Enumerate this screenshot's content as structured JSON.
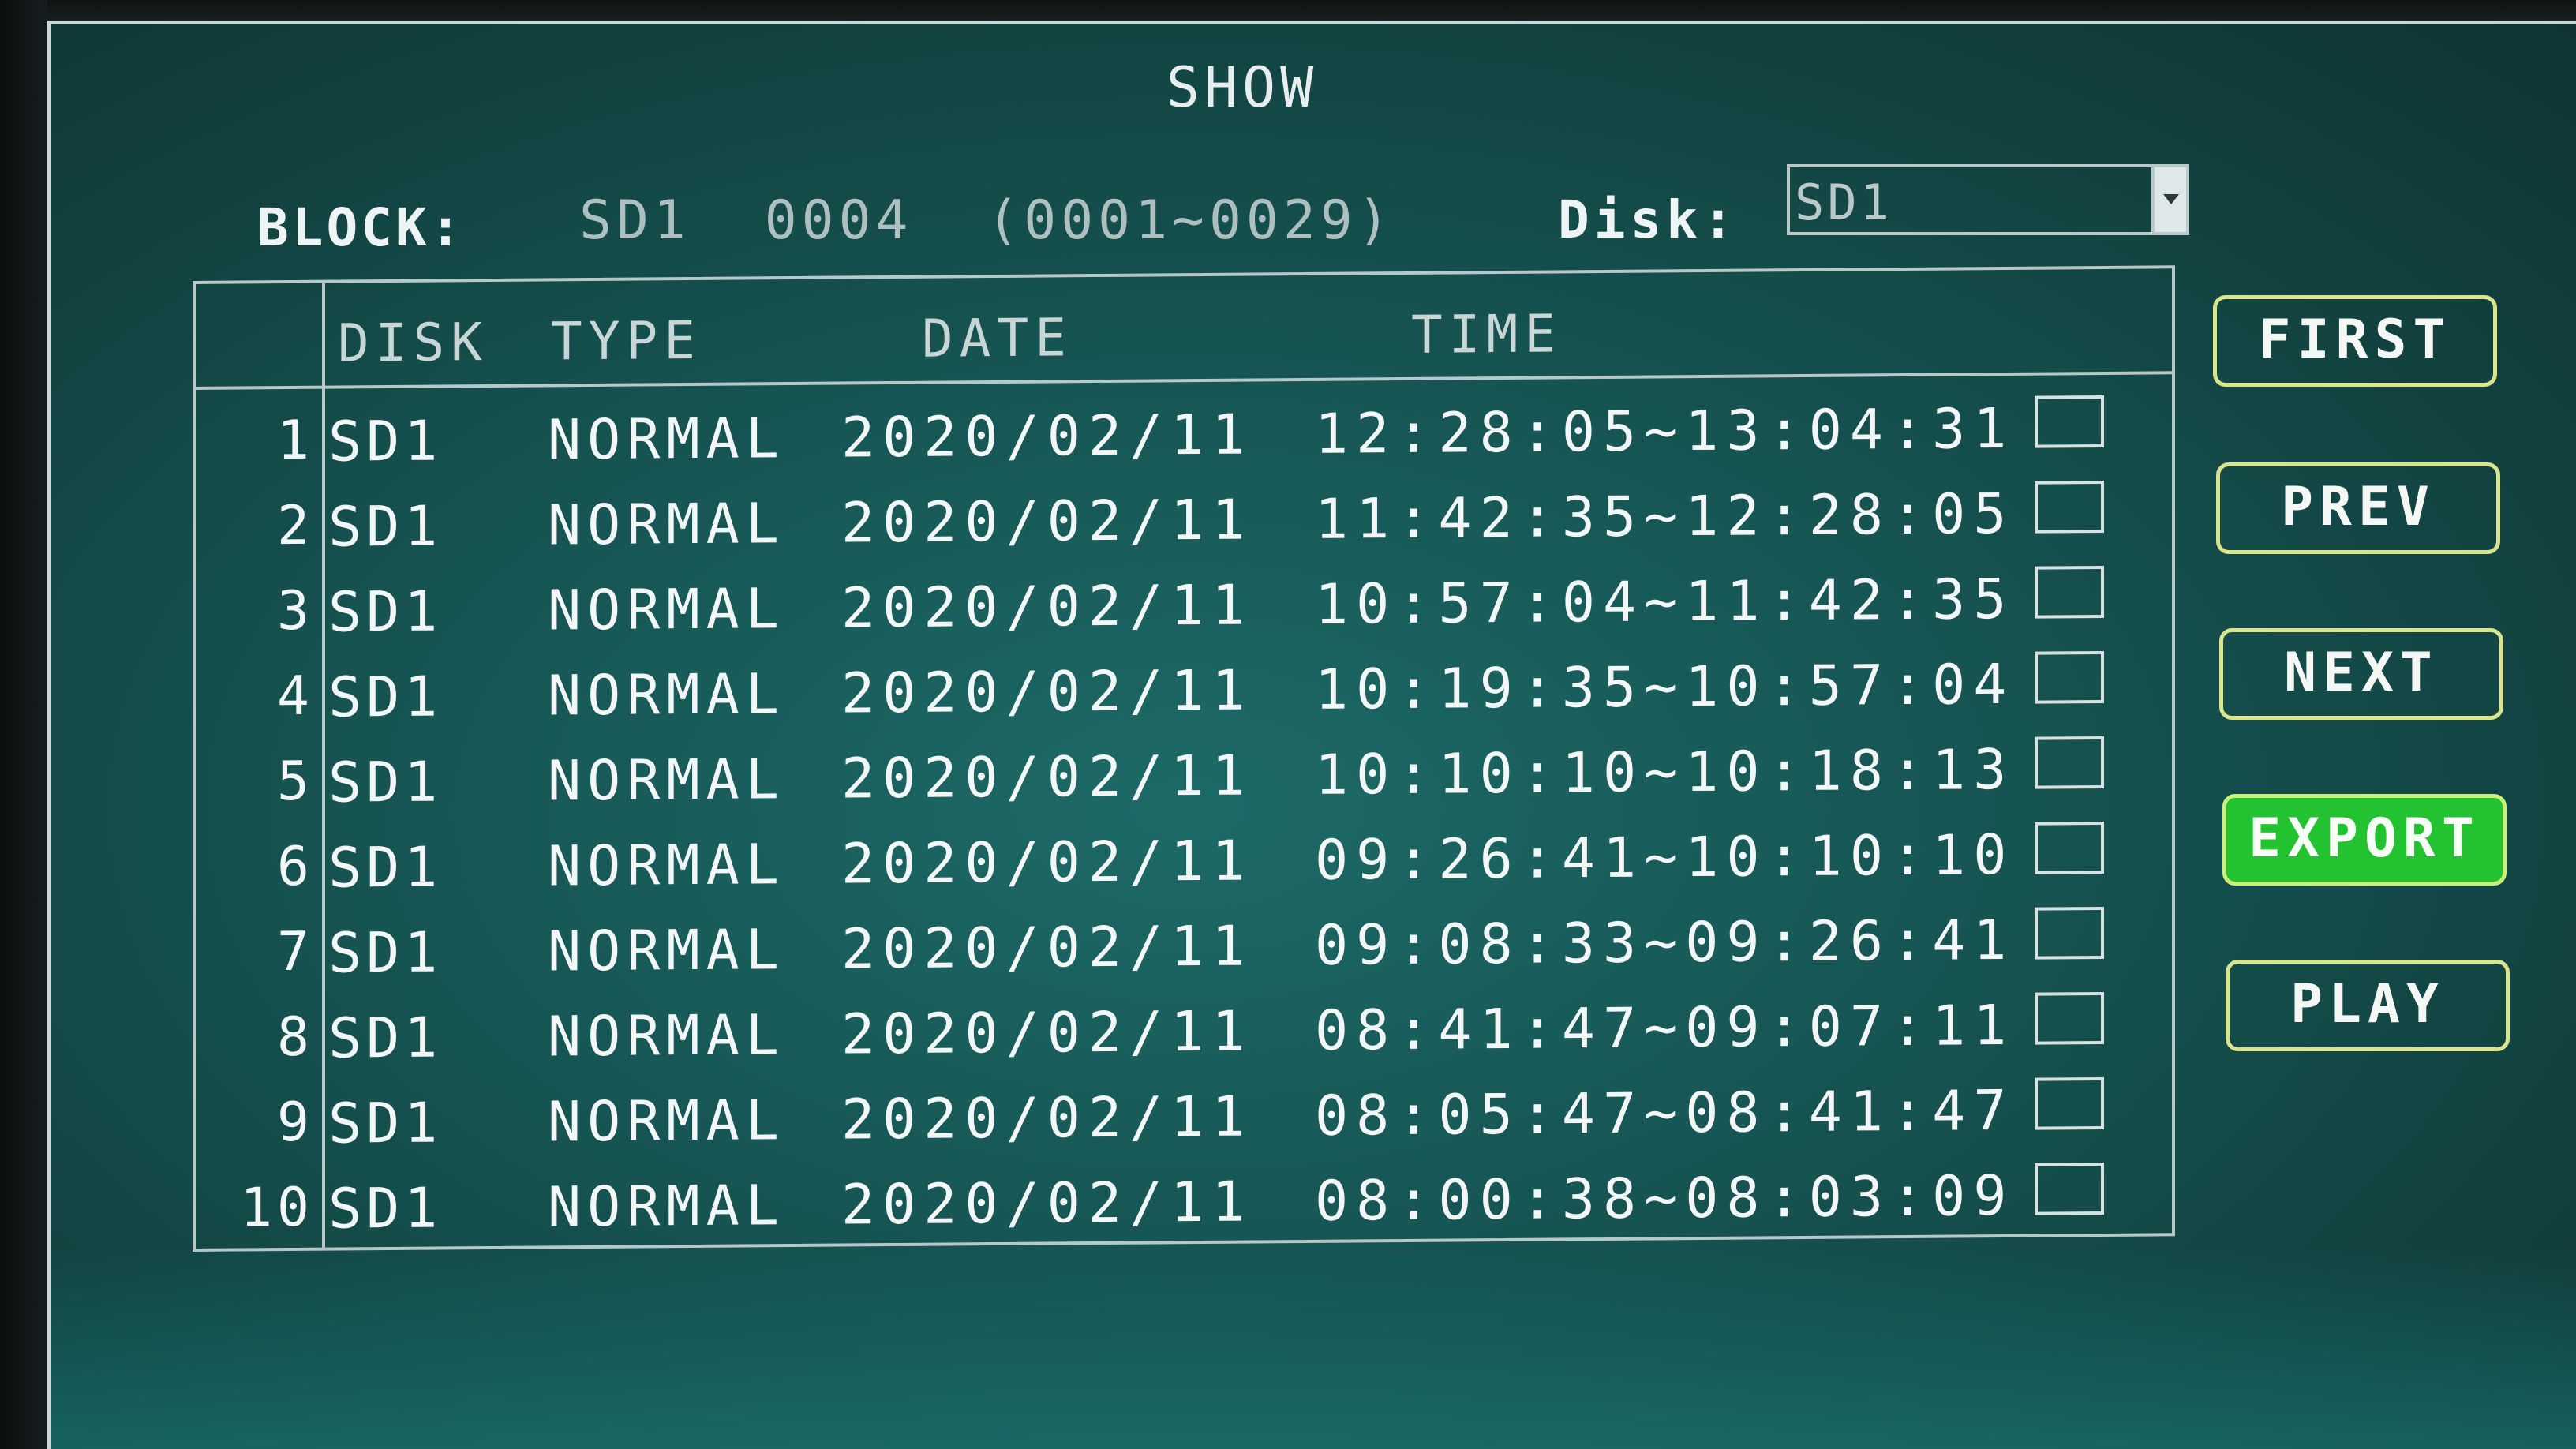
{
  "title": "SHOW",
  "block": {
    "label": "BLOCK:",
    "value": "SD1  0004  (0001~0029)"
  },
  "disk": {
    "label": "Disk:",
    "selected": "SD1"
  },
  "table": {
    "columns": [
      "DISK",
      "TYPE",
      "DATE",
      "TIME"
    ],
    "rows": [
      {
        "index": "1",
        "disk": "SD1",
        "type": "NORMAL",
        "date": "2020/02/11",
        "time": "12:28:05~13:04:31",
        "checked": false
      },
      {
        "index": "2",
        "disk": "SD1",
        "type": "NORMAL",
        "date": "2020/02/11",
        "time": "11:42:35~12:28:05",
        "checked": false
      },
      {
        "index": "3",
        "disk": "SD1",
        "type": "NORMAL",
        "date": "2020/02/11",
        "time": "10:57:04~11:42:35",
        "checked": false
      },
      {
        "index": "4",
        "disk": "SD1",
        "type": "NORMAL",
        "date": "2020/02/11",
        "time": "10:19:35~10:57:04",
        "checked": false
      },
      {
        "index": "5",
        "disk": "SD1",
        "type": "NORMAL",
        "date": "2020/02/11",
        "time": "10:10:10~10:18:13",
        "checked": false
      },
      {
        "index": "6",
        "disk": "SD1",
        "type": "NORMAL",
        "date": "2020/02/11",
        "time": "09:26:41~10:10:10",
        "checked": false
      },
      {
        "index": "7",
        "disk": "SD1",
        "type": "NORMAL",
        "date": "2020/02/11",
        "time": "09:08:33~09:26:41",
        "checked": false
      },
      {
        "index": "8",
        "disk": "SD1",
        "type": "NORMAL",
        "date": "2020/02/11",
        "time": "08:41:47~09:07:11",
        "checked": false
      },
      {
        "index": "9",
        "disk": "SD1",
        "type": "NORMAL",
        "date": "2020/02/11",
        "time": "08:05:47~08:41:47",
        "checked": false
      },
      {
        "index": "10",
        "disk": "SD1",
        "type": "NORMAL",
        "date": "2020/02/11",
        "time": "08:00:38~08:03:09",
        "checked": false
      }
    ]
  },
  "buttons": {
    "first": "FIRST",
    "prev": "PREV",
    "next": "NEXT",
    "export": "EXPORT",
    "play": "PLAY"
  },
  "colors": {
    "background": "#175856",
    "export_button": "#22c231",
    "button_border": "#d9e48c"
  }
}
